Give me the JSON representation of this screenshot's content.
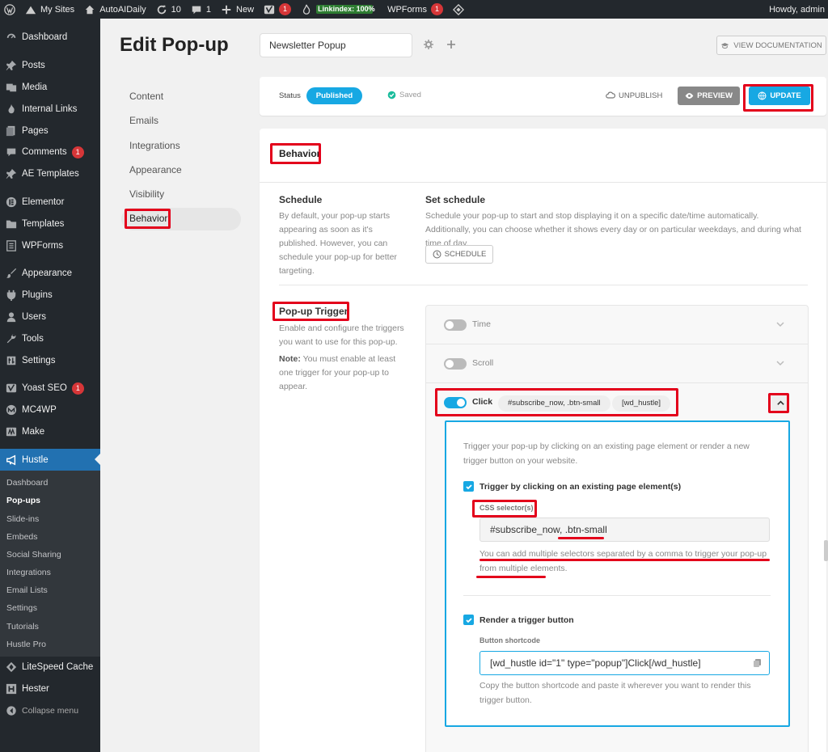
{
  "admin_bar": {
    "my_sites": "My Sites",
    "site_name": "AutoAIDaily",
    "updates_count": "10",
    "comments_count": "1",
    "new_label": "New",
    "yoast_count": "1",
    "linkindex_label": "Linkindex:",
    "linkindex_value": "100%",
    "wpforms_label": "WPForms",
    "wpforms_count": "1",
    "howdy": "Howdy, admin"
  },
  "sidebar": {
    "items": [
      {
        "label": "Dashboard",
        "icon": "dashboard-icon"
      },
      {
        "label": "Posts",
        "icon": "pin-icon"
      },
      {
        "label": "Media",
        "icon": "media-icon"
      },
      {
        "label": "Internal Links",
        "icon": "link-icon"
      },
      {
        "label": "Pages",
        "icon": "pages-icon"
      },
      {
        "label": "Comments",
        "icon": "comments-icon",
        "badge": "1"
      },
      {
        "label": "AE Templates",
        "icon": "pin-icon"
      },
      {
        "label": "Elementor",
        "icon": "elementor-icon"
      },
      {
        "label": "Templates",
        "icon": "folder-icon"
      },
      {
        "label": "WPForms",
        "icon": "forms-icon"
      },
      {
        "label": "Appearance",
        "icon": "brush-icon"
      },
      {
        "label": "Plugins",
        "icon": "plugin-icon"
      },
      {
        "label": "Users",
        "icon": "user-icon"
      },
      {
        "label": "Tools",
        "icon": "wrench-icon"
      },
      {
        "label": "Settings",
        "icon": "settings-icon"
      },
      {
        "label": "Yoast SEO",
        "icon": "yoast-icon",
        "badge": "1"
      },
      {
        "label": "MC4WP",
        "icon": "mc4wp-icon"
      },
      {
        "label": "Make",
        "icon": "make-icon"
      },
      {
        "label": "Hustle",
        "icon": "megaphone-icon"
      }
    ],
    "hustle_sub": [
      "Dashboard",
      "Pop-ups",
      "Slide-ins",
      "Embeds",
      "Social Sharing",
      "Integrations",
      "Email Lists",
      "Settings",
      "Tutorials",
      "Hustle Pro"
    ],
    "bottom": [
      {
        "label": "LiteSpeed Cache",
        "icon": "litespeed-icon"
      },
      {
        "label": "Hester",
        "icon": "hester-icon"
      },
      {
        "label": "Collapse menu",
        "icon": "collapse-icon"
      }
    ]
  },
  "page": {
    "title": "Edit Pop-up",
    "name_value": "Newsletter Popup",
    "doc_button": "VIEW DOCUMENTATION"
  },
  "tabs": [
    "Content",
    "Emails",
    "Integrations",
    "Appearance",
    "Visibility",
    "Behavior"
  ],
  "status": {
    "label": "Status",
    "value": "Published",
    "saved": "Saved",
    "unpublish": "UNPUBLISH",
    "preview": "PREVIEW",
    "update": "UPDATE"
  },
  "behavior": {
    "title": "Behavior",
    "schedule_title": "Schedule",
    "schedule_desc": "By default, your pop-up starts appearing as soon as it's published. However, you can schedule your pop-up for better targeting.",
    "set_schedule_title": "Set schedule",
    "set_schedule_desc": "Schedule your pop-up to start and stop displaying it on a specific date/time automatically. Additionally, you can choose whether it shows every day or on particular weekdays, and during what time of day.",
    "schedule_button": "SCHEDULE",
    "trigger_title": "Pop-up Trigger",
    "trigger_desc": "Enable and configure the triggers you want to use for this pop-up.",
    "note_label": "Note:",
    "note_text": " You must enable at least one trigger for your pop-up to appear."
  },
  "triggers": {
    "time_label": "Time",
    "scroll_label": "Scroll",
    "click_label": "Click",
    "click_tag_1": "#subscribe_now, .btn-small",
    "click_tag_2": "[wd_hustle]",
    "click_desc": "Trigger your pop-up by clicking on an existing page element or render a new trigger button on your website.",
    "existing_label": "Trigger by clicking on an existing page element(s)",
    "css_label": "CSS selector(s)",
    "css_value": "#subscribe_now, .btn-small",
    "css_help": "You can add multiple selectors separated by a comma to trigger your pop-up from multiple elements.",
    "render_label": "Render a trigger button",
    "shortcode_label": "Button shortcode",
    "shortcode_value": "[wd_hustle id=\"1\" type=\"popup\"]Click[/wd_hustle]",
    "shortcode_help": "Copy the button shortcode and paste it wherever you want to render this trigger button."
  },
  "colors": {
    "accent": "#17a8e3",
    "annotation": "#e3001b",
    "sidebar_bg": "#23282d",
    "active_menu": "#2271b1"
  }
}
